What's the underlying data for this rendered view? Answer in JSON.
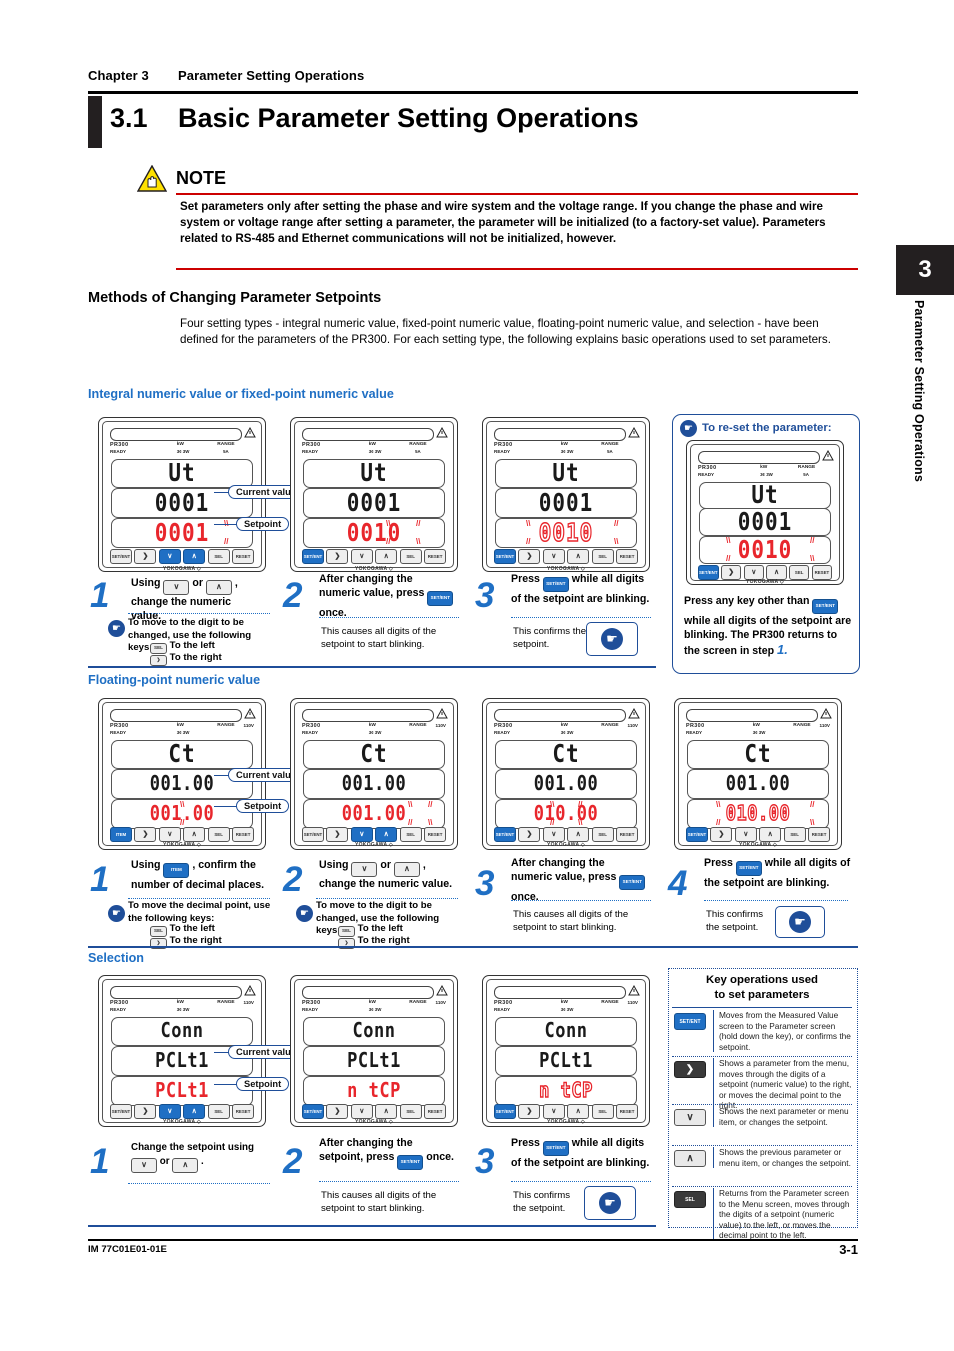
{
  "header": {
    "chapter": "Chapter 3",
    "chapter_title": "Parameter Setting Operations",
    "section_number": "3.1",
    "section_title": "Basic Parameter Setting Operations"
  },
  "side_tab": {
    "number": "3",
    "label": "Parameter Setting Operations"
  },
  "note": {
    "label": "NOTE",
    "body": "Set parameters only after setting the phase and wire system and the voltage range. If you change the phase and wire system or voltage range after setting a parameter, the parameter will be initialized (to a factory-set value). Parameters related to RS-485 and Ethernet communications will not be initialized, however."
  },
  "methods": {
    "heading": "Methods of Changing Parameter Setpoints",
    "body": "Four setting types - integral numeric value, fixed-point numeric value, floating-point numeric value, and selection - have been defined for the parameters of the PR300. For each setting type, the following explains basic operations used to set parameters."
  },
  "sections": {
    "integral": "Integral numeric value or fixed-point numeric value",
    "floating": "Floating-point numeric value",
    "selection": "Selection"
  },
  "device": {
    "logo": "PR300",
    "ready": "READY",
    "unit": "kW",
    "wire": "3¢ 3W",
    "range": "RANGE",
    "amp": "5A",
    "volt": "110V"
  },
  "callouts": {
    "current": "Current value",
    "setpoint": "Setpoint"
  },
  "panels": {
    "integral": [
      {
        "param": "Ut",
        "current": "0001",
        "setpoint": "0001",
        "setpoint_style": "red"
      },
      {
        "param": "Ut",
        "current": "0001",
        "setpoint": "0010",
        "setpoint_style": "red"
      },
      {
        "param": "Ut",
        "current": "0001",
        "setpoint": "0010",
        "setpoint_style": "redout"
      }
    ],
    "reset": {
      "param": "Ut",
      "current": "0001",
      "setpoint": "0010"
    },
    "floating": [
      {
        "param": "Ct",
        "current": "001.00",
        "setpoint": "001.00",
        "setpoint_style": "red"
      },
      {
        "param": "Ct",
        "current": "001.00",
        "setpoint": "001.00",
        "setpoint_style": "red"
      },
      {
        "param": "Ct",
        "current": "001.00",
        "setpoint": "010.00",
        "setpoint_style": "red"
      },
      {
        "param": "Ct",
        "current": "001.00",
        "setpoint": "010.00",
        "setpoint_style": "redout"
      }
    ],
    "selection": [
      {
        "param": "Conn",
        "current": "PCLt1",
        "setpoint": "PCLt1",
        "setpoint_style": "red"
      },
      {
        "param": "Conn",
        "current": "PCLt1",
        "setpoint": "n tCP",
        "setpoint_style": "red"
      },
      {
        "param": "Conn",
        "current": "PCLt1",
        "setpoint": "n tCP",
        "setpoint_style": "redout"
      }
    ]
  },
  "keys": {
    "set_ent": "SET/ENT",
    "right": "❯",
    "down": "∨",
    "up": "∧",
    "sel": "SEL",
    "reset": "RESET",
    "item": "ITEM"
  },
  "steps_integral": [
    {
      "num": "1",
      "text_a": "Using",
      "text_b": "or",
      "text_c": ", change the numeric value.",
      "sub": "To move to the digit to be changed, use the following keys:",
      "sub_left": "To the left",
      "sub_right": "To the right"
    },
    {
      "num": "2",
      "text_a": "After changing the numeric value, press",
      "text_c": "once.",
      "note": "This causes all digits of the setpoint to start blinking."
    },
    {
      "num": "3",
      "text_a": "Press",
      "text_c": "while all digits of the setpoint are blinking.",
      "note": "This confirms the setpoint."
    }
  ],
  "reset_box": {
    "title": "To re-set the parameter:",
    "text_a": "Press any key other than",
    "text_b": "while all digits of the setpoint are blinking. The PR300 returns to the screen in step",
    "step_ref": "1."
  },
  "steps_floating": [
    {
      "num": "1",
      "text_a": "Using",
      "text_c": ", confirm the number of decimal places.",
      "sub": "To move the decimal point, use the following keys:",
      "sub_left": "To the left",
      "sub_right": "To the right"
    },
    {
      "num": "2",
      "text_a": "Using",
      "text_b": "or",
      "text_c": ", change the numeric value.",
      "sub": "To move to the digit to be changed, use the following keys:",
      "sub_left": "To the left",
      "sub_right": "To the right"
    },
    {
      "num": "3",
      "text_a": "After changing the numeric value, press",
      "text_c": "once.",
      "note": "This causes all digits of the setpoint to start blinking."
    },
    {
      "num": "4",
      "text_a": "Press",
      "text_c": "while all digits of the setpoint are blinking.",
      "note": "This confirms the setpoint."
    }
  ],
  "steps_selection": [
    {
      "num": "1",
      "text_a": "Change the setpoint using",
      "text_b": "or",
      "text_c": "."
    },
    {
      "num": "2",
      "text_a": "After changing the setpoint, press",
      "text_c": "once.",
      "note": "This causes all digits of the setpoint to start blinking."
    },
    {
      "num": "3",
      "text_a": "Press",
      "text_c": "while all digits of the setpoint are blinking.",
      "note": "This confirms the setpoint."
    }
  ],
  "legend": {
    "title_l1": "Key operations used",
    "title_l2": "to set parameters",
    "rows": [
      {
        "key": "SET/ENT",
        "key_style": "blue",
        "desc": "Moves from the Measured Value screen to the Parameter screen (hold down the key), or confirms the setpoint."
      },
      {
        "key": "❯",
        "key_style": "dark",
        "desc": "Shows a parameter from the menu, moves through the digits of a setpoint (numeric value) to the right, or moves the decimal point to the right."
      },
      {
        "key": "∨",
        "key_style": "plain",
        "desc": "Shows the next parameter or menu item, or changes the setpoint."
      },
      {
        "key": "∧",
        "key_style": "plain",
        "desc": "Shows the previous parameter or menu item, or changes the setpoint."
      },
      {
        "key": "SEL",
        "key_style": "dark",
        "desc": "Returns from the Parameter screen to the Menu screen, moves through the digits of a setpoint (numeric value) to the left, or moves the decimal point to the left."
      }
    ]
  },
  "footer": {
    "doc_id": "IM 77C01E01-01E",
    "page": "3-1"
  },
  "colors": {
    "accent_blue": "#1f6fc4",
    "dark_blue": "#1f4e99",
    "red": "#e8262c",
    "black": "#231f20"
  }
}
